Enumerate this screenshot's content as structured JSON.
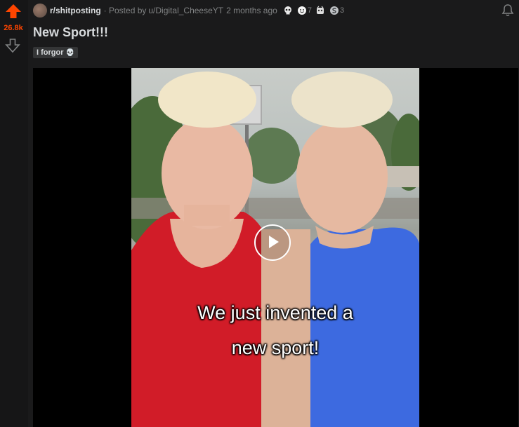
{
  "vote": {
    "score": "26.8k"
  },
  "post": {
    "subreddit": "r/shitposting",
    "posted_by_prefix": "· Posted by",
    "author": "u/Digital_CheeseYT",
    "time": "2 months ago",
    "awards": [
      {
        "icon": "skull-award-icon",
        "count": ""
      },
      {
        "icon": "wholesome-award-icon",
        "count": "7"
      },
      {
        "icon": "helpful-award-icon",
        "count": ""
      },
      {
        "icon": "silver-award-icon",
        "count": "3"
      }
    ],
    "title": "New Sport!!!",
    "flair": "I forgor",
    "flair_emoji": "💀"
  },
  "video": {
    "caption_line1": "We just invented a",
    "caption_line2": "new sport!"
  },
  "colors": {
    "upvote": "#ff4500",
    "background": "#1a1a1b"
  }
}
